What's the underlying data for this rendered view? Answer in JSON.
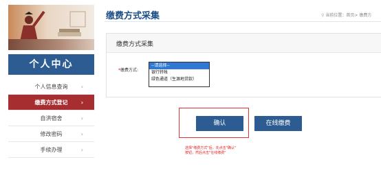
{
  "sidebar": {
    "member_title": "个人中心",
    "items": [
      {
        "label": "个人信息查询",
        "active": false
      },
      {
        "label": "缴费方式登记",
        "active": true
      },
      {
        "label": "自洪宿舍",
        "active": false
      },
      {
        "label": "修改密码",
        "active": false
      },
      {
        "label": "手续办理",
        "active": false
      }
    ],
    "chevron": "›"
  },
  "header": {
    "title": "缴费方式采集",
    "breadcrumb": "当前位置：首页> 缴费方"
  },
  "panel": {
    "title": "缴费方式采集",
    "field_label": "缴费方式:",
    "required_mark": "*",
    "select_options": [
      {
        "label": "--请选择--",
        "selected": true
      },
      {
        "label": "银行转帐",
        "selected": false
      },
      {
        "label": "绿色通道（生源地贷款）",
        "selected": false
      }
    ]
  },
  "actions": {
    "confirm_label": "确认",
    "online_pay_label": "在线缴费"
  },
  "hint": {
    "line1": "选择\"缴费方式\"后，先点击\"确认\"",
    "line2": "按钮，然后点击\"在线缴费\""
  },
  "colors": {
    "brand_blue": "#2d5c92",
    "active_red": "#a72e30",
    "hint_red": "#d22222"
  }
}
